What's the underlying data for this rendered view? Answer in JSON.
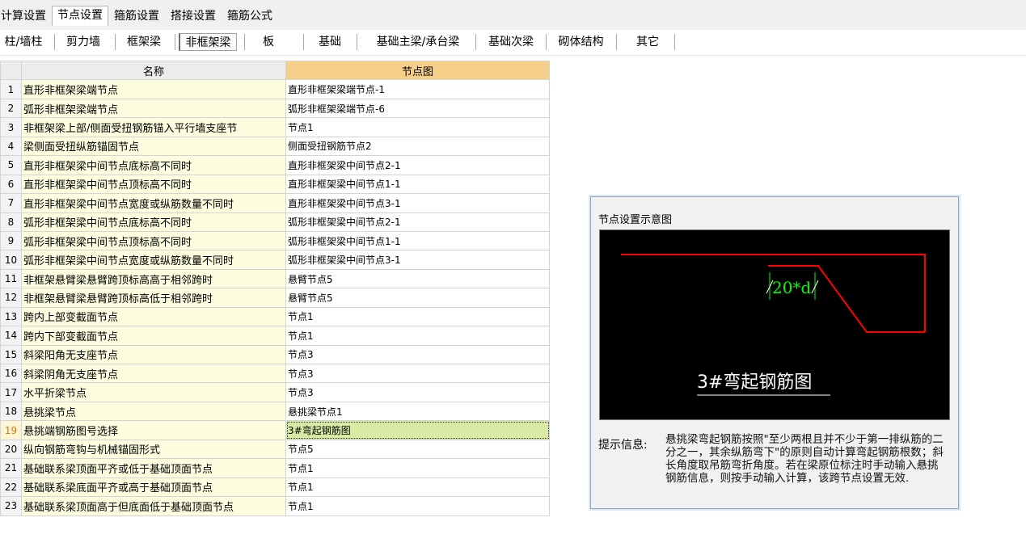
{
  "tabs": [
    "计算设置",
    "节点设置",
    "箍筋设置",
    "搭接设置",
    "箍筋公式"
  ],
  "active_tab": "节点设置",
  "subtabs": [
    "柱/墙柱",
    "剪力墙",
    "框架梁",
    "非框架梁",
    "板",
    "基础",
    "基础主梁/承台梁",
    "基础次梁",
    "砌体结构",
    "其它"
  ],
  "active_subtab": "非框架梁",
  "table": {
    "headers": [
      "名称",
      "节点图"
    ],
    "selected_row": 19,
    "rows": [
      {
        "num": "1",
        "name": "直形非框架梁端节点",
        "value": "直形非框架梁端节点-1"
      },
      {
        "num": "2",
        "name": "弧形非框架梁端节点",
        "value": "弧形非框架梁端节点-6"
      },
      {
        "num": "3",
        "name": "非框架梁上部/侧面受扭钢筋锚入平行墙支座节",
        "value": "节点1"
      },
      {
        "num": "4",
        "name": "梁侧面受扭纵筋锚固节点",
        "value": "侧面受扭钢筋节点2"
      },
      {
        "num": "5",
        "name": "直形非框架梁中间节点底标高不同时",
        "value": "直形非框架梁中间节点2-1"
      },
      {
        "num": "6",
        "name": "直形非框架梁中间节点顶标高不同时",
        "value": "直形非框架梁中间节点1-1"
      },
      {
        "num": "7",
        "name": "直形非框架梁中间节点宽度或纵筋数量不同时",
        "value": "直形非框架梁中间节点3-1"
      },
      {
        "num": "8",
        "name": "弧形非框架梁中间节点底标高不同时",
        "value": "弧形非框架梁中间节点2-1"
      },
      {
        "num": "9",
        "name": "弧形非框架梁中间节点顶标高不同时",
        "value": "弧形非框架梁中间节点1-1"
      },
      {
        "num": "10",
        "name": "弧形非框架梁中间节点宽度或纵筋数量不同时",
        "value": "弧形非框架梁中间节点3-1"
      },
      {
        "num": "11",
        "name": "非框架悬臂梁悬臂跨顶标高高于相邻跨时",
        "value": "悬臂节点5"
      },
      {
        "num": "12",
        "name": "非框架悬臂梁悬臂跨顶标高低于相邻跨时",
        "value": "悬臂节点5"
      },
      {
        "num": "13",
        "name": "跨内上部变截面节点",
        "value": "节点1"
      },
      {
        "num": "14",
        "name": "跨内下部变截面节点",
        "value": "节点1"
      },
      {
        "num": "15",
        "name": "斜梁阳角无支座节点",
        "value": "节点3"
      },
      {
        "num": "16",
        "name": "斜梁阴角无支座节点",
        "value": "节点3"
      },
      {
        "num": "17",
        "name": "水平折梁节点",
        "value": "节点3"
      },
      {
        "num": "18",
        "name": "悬挑梁节点",
        "value": "悬挑梁节点1"
      },
      {
        "num": "19",
        "name": "悬挑端钢筋图号选择",
        "value": "3#弯起钢筋图"
      },
      {
        "num": "20",
        "name": "纵向钢筋弯钩与机械锚固形式",
        "value": "节点5"
      },
      {
        "num": "21",
        "name": "基础联系梁顶面平齐或低于基础顶面节点",
        "value": "节点1"
      },
      {
        "num": "22",
        "name": "基础联系梁底面平齐或高于基础顶面节点",
        "value": "节点1"
      },
      {
        "num": "23",
        "name": "基础联系梁顶面高于但底面低于基础顶面节点",
        "value": "节点1"
      }
    ]
  },
  "preview": {
    "title": "节点设置示意图",
    "dimension_label": "20*d",
    "caption": "3#弯起钢筋图",
    "hint_label": "提示信息:",
    "hint_text": "悬挑梁弯起钢筋按照\"至少两根且并不少于第一排纵筋的二分之一，其余纵筋弯下\"的原则自动计算弯起钢筋根数；斜长角度取吊筋弯折角度。若在梁原位标注时手动输入悬挑钢筋信息，则按手动输入计算，该跨节点设置无效."
  },
  "colors": {
    "rebar": "#ff0000",
    "dimension": "#00ff00",
    "caption": "#ffffff",
    "name_cell_bg": "#fdfde0",
    "selected_value_bg": "#d9eaa4",
    "header_highlight": "#f6d08a"
  }
}
